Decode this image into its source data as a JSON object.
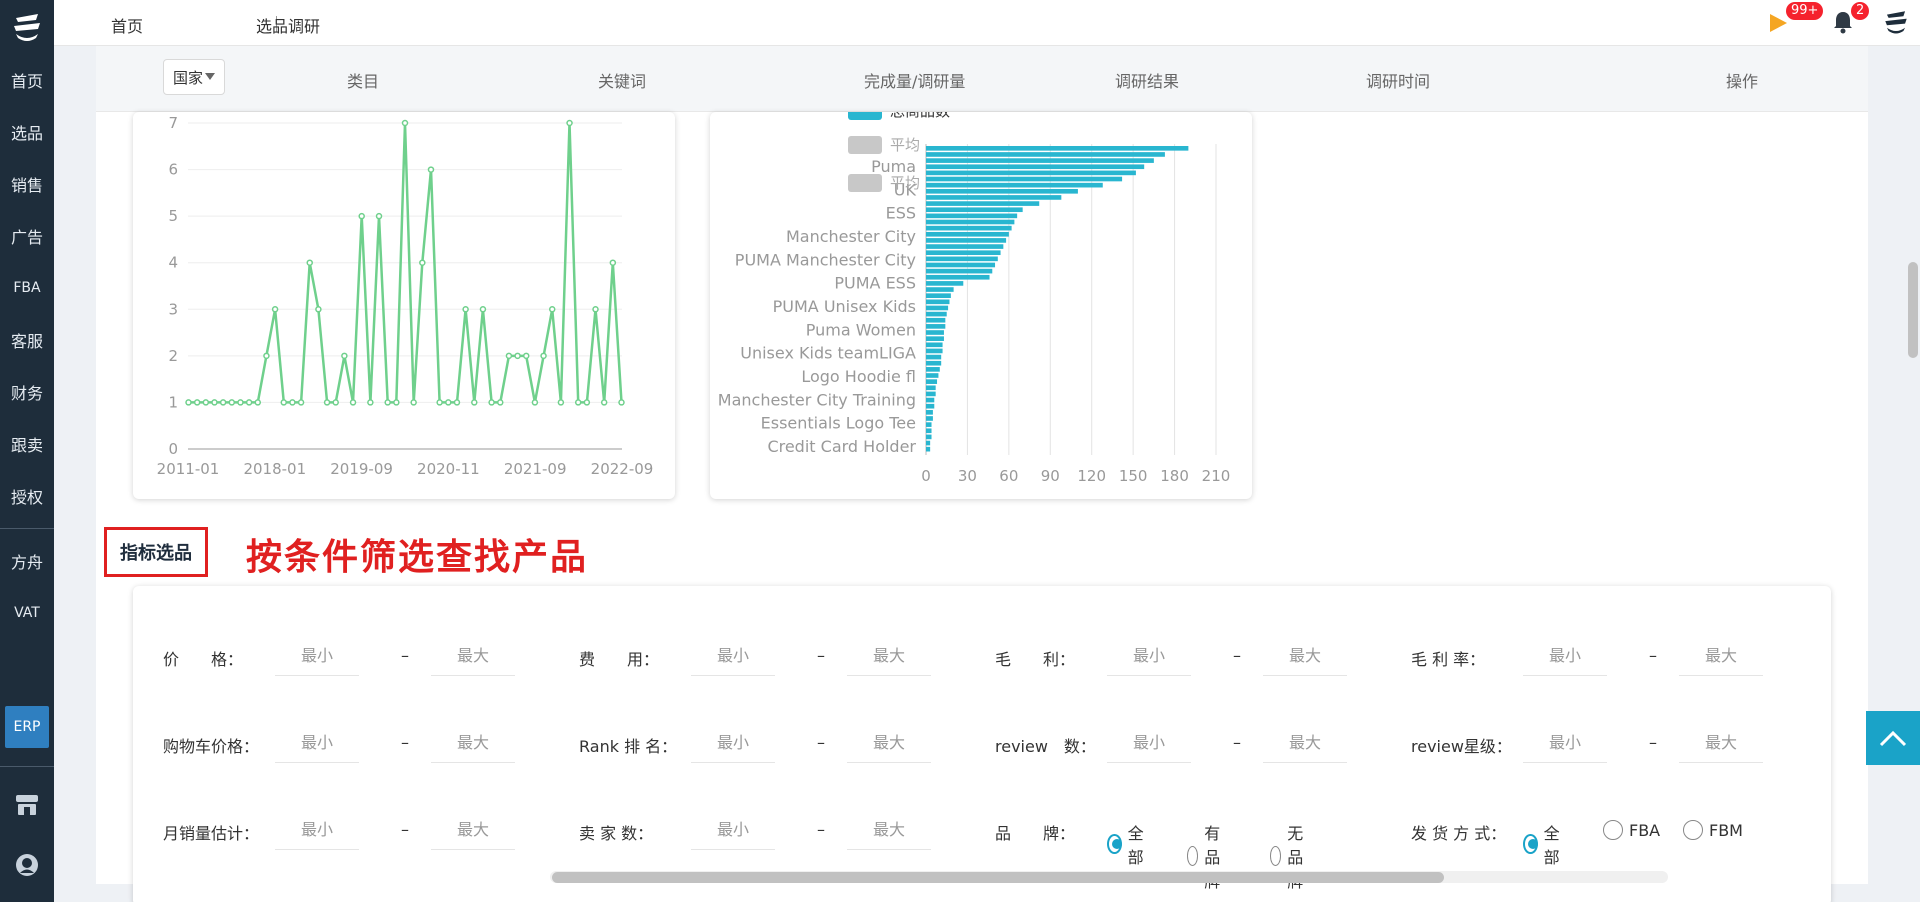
{
  "sidebar": {
    "logo_icon": "ship-logo-icon",
    "items": [
      {
        "label": "首页"
      },
      {
        "label": "选品"
      },
      {
        "label": "销售"
      },
      {
        "label": "广告"
      },
      {
        "label": "FBA"
      },
      {
        "label": "客服"
      },
      {
        "label": "财务"
      },
      {
        "label": "跟卖"
      },
      {
        "label": "授权"
      }
    ],
    "items2": [
      {
        "label": "方舟"
      },
      {
        "label": "VAT"
      }
    ],
    "erp_label": "ERP",
    "bottom_icons": [
      "store-icon",
      "support-icon"
    ]
  },
  "topbar": {
    "home": "首页",
    "current_tab": "选品调研",
    "flag_badge": "99+",
    "bell_badge": "2",
    "accent": "#f5a623"
  },
  "table_header": {
    "country": "国家",
    "columns": [
      "类目",
      "关键词",
      "完成量/调研量",
      "调研结果",
      "调研时间",
      "操作"
    ]
  },
  "line_chart": {
    "chart_data": {
      "type": "line",
      "x": [
        "2011-01",
        "2018-01",
        "2019-09",
        "2020-11",
        "2021-09",
        "2022-09"
      ],
      "y_ticks": [
        0,
        1,
        2,
        3,
        4,
        5,
        6,
        7
      ],
      "ylim": [
        0,
        7
      ],
      "values": [
        1,
        1,
        1,
        1,
        1,
        1,
        1,
        1,
        1,
        2,
        3,
        1,
        1,
        1,
        4,
        3,
        1,
        1,
        2,
        1,
        5,
        1,
        5,
        1,
        1,
        7,
        1,
        4,
        6,
        1,
        1,
        1,
        3,
        1,
        3,
        1,
        1,
        2,
        2,
        2,
        1,
        2,
        3,
        1,
        7,
        1,
        1,
        3,
        1,
        4,
        1
      ],
      "color": "#6fd08c"
    }
  },
  "bar_chart": {
    "chart_data": {
      "type": "bar",
      "orientation": "horizontal",
      "legend": [
        "总商品数",
        "平均",
        "平均"
      ],
      "categories": [
        "Puma",
        "UK",
        "ESS",
        "Manchester City",
        "PUMA Manchester City",
        "PUMA ESS",
        "PUMA Unisex Kids",
        "Puma Women",
        "Unisex Kids teamLIGA",
        "Logo Hoodie fl",
        "Manchester City Training",
        "Essentials Logo Tee",
        "Credit Card Holder"
      ],
      "values": [
        190,
        173,
        165,
        158,
        152,
        142,
        128,
        110,
        98,
        82,
        70,
        66,
        64,
        62,
        60,
        58,
        56,
        54,
        52,
        50,
        48,
        46,
        27,
        20,
        18,
        17,
        16,
        15,
        14,
        14,
        13,
        13,
        12,
        12,
        11,
        11,
        10,
        9,
        8,
        7,
        7,
        6,
        6,
        5,
        5,
        4,
        4,
        4,
        3,
        3
      ],
      "x_ticks": [
        0,
        30,
        60,
        90,
        120,
        150,
        180,
        210
      ],
      "xlim": [
        0,
        210
      ],
      "color": "#29b6d0"
    }
  },
  "section": {
    "title": "指标选品",
    "annotation": "按条件筛选查找产品"
  },
  "filters": {
    "min_placeholder": "最小",
    "max_placeholder": "最大",
    "dash": "–",
    "row1": [
      "价　　格：",
      "费　　用：",
      "毛　　利：",
      "毛 利 率："
    ],
    "row2": [
      "购物车价格：",
      "Rank 排 名：",
      "review　数：",
      "review星级："
    ],
    "row3": [
      "月销量估计：",
      "卖 家 数："
    ],
    "brand_label": "品　　牌：",
    "brand_options": [
      "全部",
      "有品牌",
      "无品牌"
    ],
    "ship_label": "发 货 方 式：",
    "ship_options": [
      "全部",
      "FBA",
      "FBM"
    ]
  }
}
